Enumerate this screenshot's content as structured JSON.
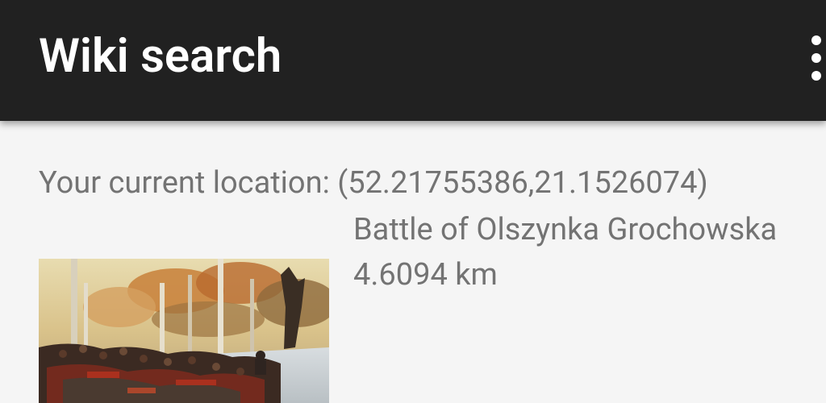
{
  "app_bar": {
    "title": "Wiki search",
    "background": "#212121",
    "menu_icon": "more-vert-icon"
  },
  "location": {
    "text": "Your current location: (52.21755386,21.1526074)"
  },
  "results": [
    {
      "title": "Battle of Olszynka Grochowska",
      "distance": "4.6094 km",
      "thumbnail": "battle-painting-image"
    }
  ],
  "colors": {
    "background": "#f5f5f5",
    "text_secondary": "#737373",
    "app_bar_text": "#ffffff"
  }
}
